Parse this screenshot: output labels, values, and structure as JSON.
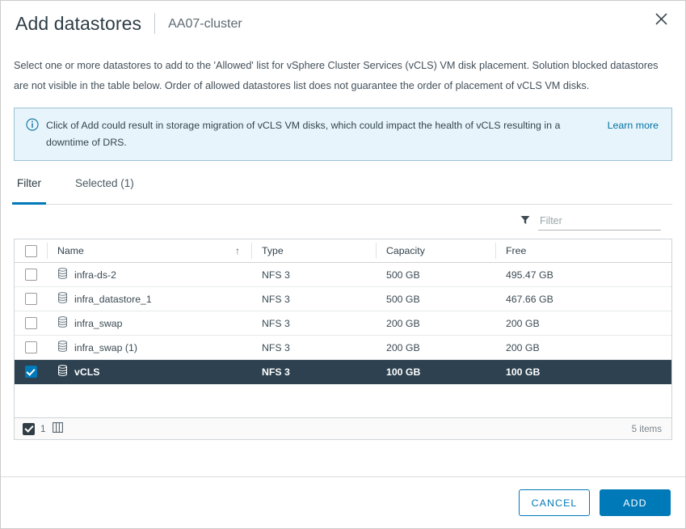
{
  "header": {
    "title": "Add datastores",
    "subtitle": "AA07-cluster",
    "close_icon": "close-icon"
  },
  "description": "Select one or more datastores to add to the 'Allowed' list for vSphere Cluster Services (vCLS) VM disk placement. Solution blocked datastores are not visible in the table below. Order of allowed datastores list does not guarantee the order of placement of vCLS VM disks.",
  "banner": {
    "icon": "info-circle-icon",
    "text": "Click of Add could result in storage migration of vCLS VM disks, which could impact the health of vCLS resulting in a downtime of DRS.",
    "link_label": "Learn more",
    "bg_color": "#e8f4fb",
    "border_color": "#9bc2d6",
    "link_color": "#0072a3"
  },
  "tabs": [
    {
      "label": "Filter",
      "active": true
    },
    {
      "label": "Selected (1)",
      "active": false
    }
  ],
  "filter": {
    "icon": "funnel-icon",
    "placeholder": "Filter",
    "value": ""
  },
  "table": {
    "columns": [
      {
        "key": "name",
        "label": "Name",
        "sort": "ascending",
        "sort_icon": "arrow-up-icon"
      },
      {
        "key": "type",
        "label": "Type"
      },
      {
        "key": "capacity",
        "label": "Capacity"
      },
      {
        "key": "free",
        "label": "Free"
      }
    ],
    "rows": [
      {
        "name": "infra-ds-2",
        "type": "NFS 3",
        "capacity": "500 GB",
        "free": "495.47 GB",
        "selected": false,
        "icon": "datastore-icon"
      },
      {
        "name": "infra_datastore_1",
        "type": "NFS 3",
        "capacity": "500 GB",
        "free": "467.66 GB",
        "selected": false,
        "icon": "datastore-icon"
      },
      {
        "name": "infra_swap",
        "type": "NFS 3",
        "capacity": "200 GB",
        "free": "200 GB",
        "selected": false,
        "icon": "datastore-icon"
      },
      {
        "name": "infra_swap (1)",
        "type": "NFS 3",
        "capacity": "200 GB",
        "free": "200 GB",
        "selected": false,
        "icon": "datastore-icon"
      },
      {
        "name": "vCLS",
        "type": "NFS 3",
        "capacity": "100 GB",
        "free": "100 GB",
        "selected": true,
        "icon": "datastore-icon"
      }
    ],
    "footer": {
      "selected_count": "1",
      "columns_icon": "column-layout-icon",
      "item_count": "5 items"
    },
    "selected_row_bg": "#2d4150",
    "checkbox_accent": "#0079b8"
  },
  "actions": {
    "cancel_label": "CANCEL",
    "add_label": "ADD",
    "primary_color": "#0079b8"
  }
}
